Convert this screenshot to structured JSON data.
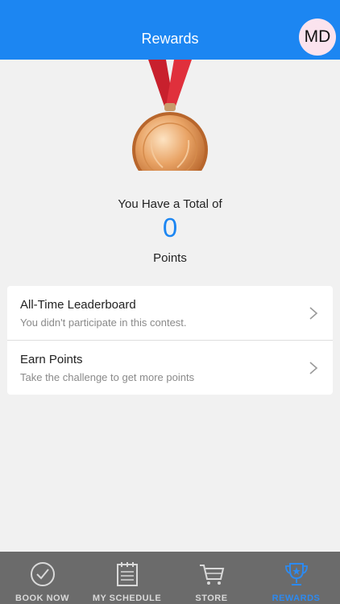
{
  "header": {
    "title": "Rewards",
    "avatar_initials": "MD"
  },
  "summary": {
    "total_label": "You Have a Total of",
    "points": "0",
    "points_unit": "Points"
  },
  "menu": [
    {
      "title": "All-Time Leaderboard",
      "subtitle": "You didn't participate in this contest."
    },
    {
      "title": "Earn Points",
      "subtitle": "Take the challenge to get more points"
    }
  ],
  "tabs": [
    {
      "label": "BOOK NOW",
      "icon": "check-circle-icon"
    },
    {
      "label": "MY SCHEDULE",
      "icon": "calendar-icon"
    },
    {
      "label": "STORE",
      "icon": "cart-icon"
    },
    {
      "label": "REWARDS",
      "icon": "trophy-icon",
      "active": true
    }
  ],
  "colors": {
    "header": "#1c86f2",
    "accent": "#1c86f2",
    "tabbar": "#6b6b6b",
    "active_tab": "#2d8af0"
  }
}
